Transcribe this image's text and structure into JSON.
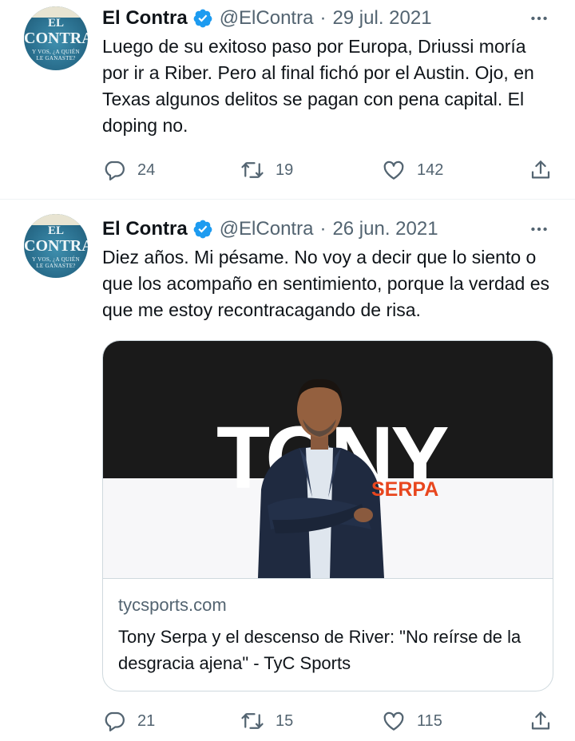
{
  "tweets": [
    {
      "author_name": "El Contra",
      "handle": "@ElContra",
      "separator": "·",
      "date": "29 jul. 2021",
      "text": "Luego de su exitoso paso por Europa, Driussi moría por ir a Riber. Pero al final fichó por el Austin. Ojo, en Texas algunos delitos se pagan con pena capital. El doping no.",
      "replies": "24",
      "retweets": "19",
      "likes": "142",
      "avatar": {
        "line1": "EL",
        "line2": "CONTRA",
        "line3": "Y VOS, ¿A QUIÉN",
        "line4": "LE GANASTE?"
      }
    },
    {
      "author_name": "El Contra",
      "handle": "@ElContra",
      "separator": "·",
      "date": "26 jun. 2021",
      "text": "Diez años. Mi pésame. No voy a decir que lo siento o que los acompaño en sentimiento, porque la verdad es que me estoy recontracagando de risa.",
      "replies": "21",
      "retweets": "15",
      "likes": "115",
      "avatar": {
        "line1": "EL",
        "line2": "CONTRA",
        "line3": "Y VOS, ¿A QUIÉN",
        "line4": "LE GANASTE?"
      },
      "card": {
        "image_word": "TONY",
        "image_subword": "SERPA",
        "domain": "tycsports.com",
        "title": "Tony Serpa y el descenso de River: \"No reírse de la desgracia ajena\" - TyC Sports"
      }
    }
  ],
  "icons": {
    "verified": "verified-badge-icon",
    "more": "more-options-icon",
    "reply": "reply-icon",
    "retweet": "retweet-icon",
    "like": "like-icon",
    "share": "share-icon"
  },
  "colors": {
    "text": "#0f1419",
    "muted": "#536471",
    "verified": "#1d9bf0",
    "border": "#cfd9de",
    "accent_orange": "#e8461e"
  }
}
